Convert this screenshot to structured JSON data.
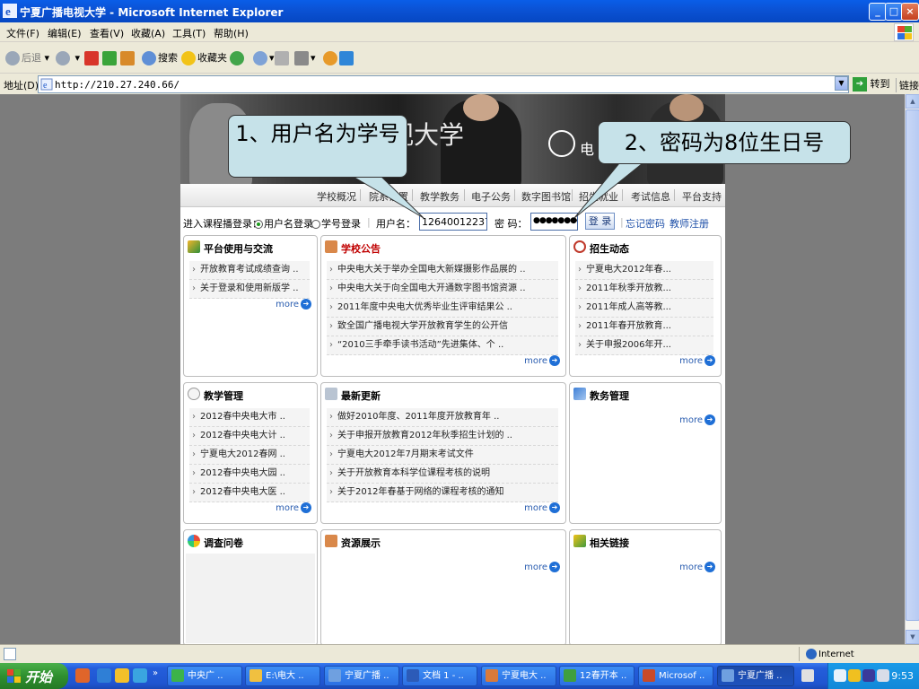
{
  "window": {
    "title": "宁夏广播电视大学 - Microsoft Internet Explorer",
    "controls": [
      "_",
      "□",
      "×"
    ]
  },
  "menu": [
    "文件(F)",
    "编辑(E)",
    "查看(V)",
    "收藏(A)",
    "工具(T)",
    "帮助(H)"
  ],
  "toolbar": {
    "back": "后退",
    "search": "搜索",
    "favorites": "收藏夹"
  },
  "address": {
    "label": "地址(D)",
    "url": "http://210.27.240.66/",
    "go": "转到",
    "links": "链接"
  },
  "banner": {
    "title": "视大学",
    "logo_text": "电"
  },
  "nav": [
    "学校概况",
    "院系设置",
    "教学教务",
    "电子公务",
    "数字图书馆",
    "招生就业",
    "考试信息",
    "平台支持"
  ],
  "login": {
    "prompt": "进入课程播登录：",
    "opt_username": "用户名登录",
    "opt_studentid": "学号登录",
    "username_label": "用户名：",
    "username_value": "1264001223709",
    "password_label": "密  码：",
    "password_value": "●●●●●●●●",
    "login_btn": "登 录",
    "forgot": "忘记密码",
    "register": "教师注册"
  },
  "panels": {
    "platform": {
      "title": "平台使用与交流",
      "items": [
        "开放教育考试成绩查询 ..",
        "关于登录和使用新版学 .."
      ],
      "more": "more"
    },
    "notice": {
      "title": "学校公告",
      "items": [
        "中央电大关于举办全国电大新媒摄影作品展的 ..",
        "中央电大关于向全国电大开通数字图书馆资源 ..",
        "2011年度中央电大优秀毕业生评审结果公 ..",
        "致全国广播电视大学开放教育学生的公开信",
        "“2010三手牵手读书活动”先进集体、个 .."
      ],
      "more": "more"
    },
    "admission": {
      "title": "招生动态",
      "items": [
        "宁夏电大2012年春...",
        "2011年秋季开放教...",
        "2011年成人高等教...",
        "2011年春开放教育...",
        "关于申报2006年开..."
      ],
      "more": "more"
    },
    "teaching": {
      "title": "教学管理",
      "items": [
        "2012春中央电大市 ..",
        "2012春中央电大计 ..",
        "宁夏电大2012春网 ..",
        "2012春中央电大园 ..",
        "2012春中央电大医 .."
      ],
      "more": "more"
    },
    "latest": {
      "title": "最新更新",
      "items": [
        "做好2010年度、2011年度开放教育年 ..",
        "关于申报开放教育2012年秋季招生计划的 ..",
        "宁夏电大2012年7月期末考试文件",
        "关于开放教育本科学位课程考核的说明",
        "关于2012年春基于网络的课程考核的通知"
      ],
      "more": "more"
    },
    "affairs": {
      "title": "教务管理",
      "more": "more"
    },
    "survey": {
      "title": "调查问卷"
    },
    "resources": {
      "title": "资源展示",
      "more": "more"
    },
    "links": {
      "title": "相关链接",
      "more": "more"
    }
  },
  "callouts": {
    "username": "1、用户名为学号",
    "password": "2、密码为8位生日号"
  },
  "status": {
    "zone": "Internet"
  },
  "taskbar": {
    "start": "开始",
    "tasks": [
      "中央广 ..",
      "E:\\电大 ..",
      "宁夏广播 ..",
      "文档 1 - ..",
      "宁夏电大 ..",
      "12春开本 ..",
      "Microsof ..",
      "宁夏广播 .."
    ],
    "clock": "9:53"
  },
  "colors": {
    "title_bar": "#0b53d6",
    "notice_title": "#c00000",
    "callout_bg": "#c6e2e9",
    "more_link": "#2a5db0"
  }
}
